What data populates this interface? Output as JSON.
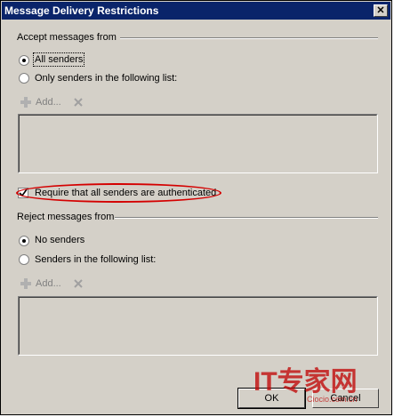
{
  "window": {
    "title": "Message Delivery Restrictions",
    "close_glyph": "✕"
  },
  "accept": {
    "group_label": "Accept messages from",
    "option_all": "All senders",
    "option_only": "Only senders in the following list:",
    "selected": "all",
    "add_label": "Add..."
  },
  "require_auth": {
    "label": "Require that all senders are authenticated",
    "checked": true
  },
  "reject": {
    "group_label": "Reject messages from",
    "option_none": "No senders",
    "option_list": "Senders in the following list:",
    "selected": "none",
    "add_label": "Add..."
  },
  "buttons": {
    "ok": "OK",
    "cancel": "Cancel"
  },
  "watermark": {
    "text": "IT专家网",
    "sub": "Ciocio.com.cn"
  },
  "colors": {
    "title_bar": "#0a246a",
    "annotation": "#d40000",
    "face": "#d4d0c8",
    "watermark": "#c00000"
  },
  "icons": {
    "add": "green-plus-icon",
    "remove": "x-icon",
    "checkmark": "check-icon"
  }
}
